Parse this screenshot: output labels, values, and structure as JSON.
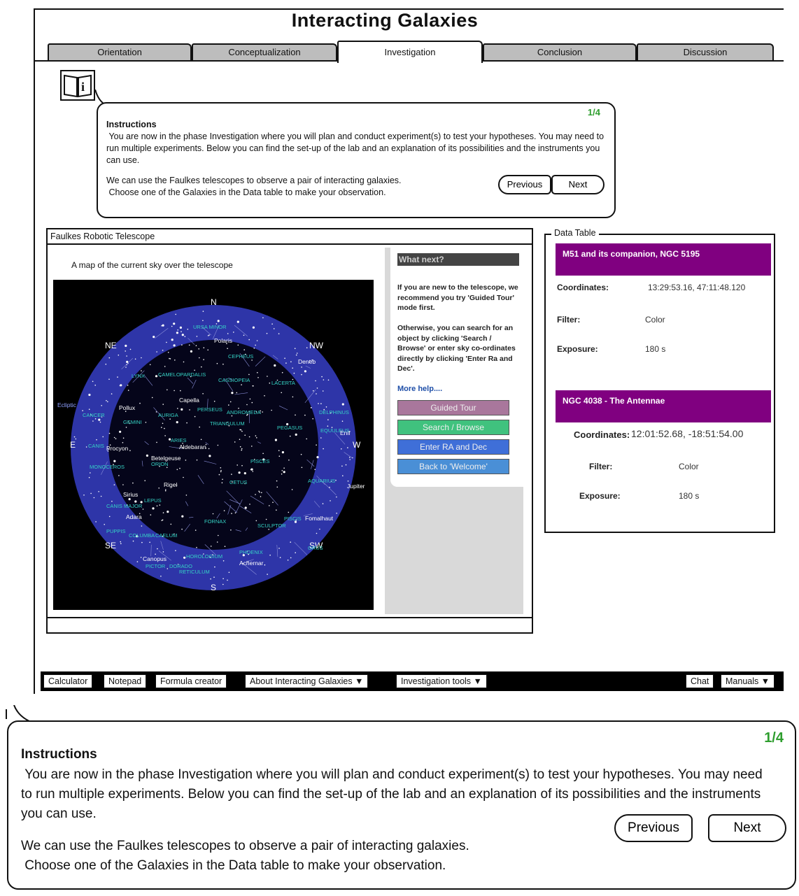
{
  "app": {
    "title": "Interacting Galaxies"
  },
  "tabs": [
    {
      "label": "Orientation"
    },
    {
      "label": "Conceptualization"
    },
    {
      "label": "Investigation",
      "active": true
    },
    {
      "label": "Conclusion"
    },
    {
      "label": "Discussion"
    }
  ],
  "instructions": {
    "counter": "1/4",
    "title": "Instructions",
    "paragraph1": " You are now in the phase Investigation where you will plan and conduct experiment(s) to test your hypotheses. You may need to run multiple experiments. Below you can find the set-up of the lab and an explanation of its possibilities and the instruments you can use.",
    "paragraph2": "We can use the Faulkes telescopes to observe a pair of interacting galaxies.\n Choose one of the Galaxies in the Data table to make your observation.",
    "previous_label": "Previous",
    "next_label": "Next"
  },
  "telescope": {
    "header": "Faulkes Robotic Telescope",
    "map_caption": "A map of the current sky over the telescope",
    "compass": {
      "n": "N",
      "s": "S",
      "e": "E",
      "w": "W",
      "ne": "NE",
      "nw": "NW",
      "se": "SE",
      "sw": "SW"
    },
    "sky_labels": [
      "URSA MINOR",
      "Polaris",
      "CEPHEUS",
      "Deneb",
      "LYNX",
      "CAMELOPARDALIS",
      "CASSIOPEIA",
      "LACERTA",
      "Ecliptic",
      "Pollux",
      "Capella",
      "PERSEUS",
      "ANDROMEDA",
      "DELPHINUS",
      "CANCER",
      "GEMINI",
      "AURIGA",
      "TRIANGULUM",
      "PEGASUS",
      "EQUULEUS",
      "Enif",
      "CANIS",
      "Procyon",
      "Aldebaran",
      "ARIES",
      "Betelgeuse",
      "MONOCEROS",
      "ORION",
      "PISCES",
      "AQUARIUS",
      "Jupiter",
      "Rigel",
      "CETUS",
      "Sirius",
      "LEPUS",
      "CANIS MAJOR",
      "Adara",
      "FORNAX",
      "SCULPTOR",
      "PISCIS",
      "Fomalhaut",
      "PUPPIS",
      "COLUMBA",
      "CAELUM",
      "GRUS",
      "Canopus",
      "HOROLOGIUM",
      "PHOENIX",
      "Achernar",
      "PICTOR",
      "DORADO",
      "RETICULUM"
    ],
    "what_next_title": "What next?",
    "what_next_text1": "If you are new to the telescope, we recommend you try 'Guided Tour' mode first.",
    "what_next_text2": "Otherwise, you can search for an object by clicking 'Search / Browse' or enter sky co-ordinates directly by clicking 'Enter Ra and Dec'.",
    "more_help": "More help....",
    "buttons": {
      "guided_tour": "Guided Tour",
      "search_browse": "Search / Browse",
      "enter_ra_dec": "Enter RA and Dec",
      "back_welcome": "Back to 'Welcome'"
    },
    "button_colors": {
      "guided_tour": "#a9779c",
      "search_browse": "#40c27e",
      "enter_ra_dec": "#3f6fd8",
      "back_welcome": "#4a8fd6"
    }
  },
  "data_table": {
    "legend": "Data Table",
    "galaxies": [
      {
        "name": "M51 and its companion, NGC 5195",
        "coordinates_label": "Coordinates:",
        "coordinates": "13:29:53.16, 47:11:48.120",
        "filter_label": "Filter:",
        "filter": "Color",
        "exposure_label": "Exposure:",
        "exposure": "180 s"
      },
      {
        "name": "NGC 4038 - The Antennae",
        "coordinates_label": "Coordinates:",
        "coordinates": "12:01:52.68, -18:51:54.00",
        "filter_label": "Filter:",
        "filter": "Color",
        "exposure_label": "Exposure:",
        "exposure": "180 s"
      }
    ],
    "header_color": "#800080"
  },
  "toolbar": {
    "calculator": "Calculator",
    "notepad": "Notepad",
    "formula_creator": "Formula creator",
    "about": "About Interacting Galaxies  ▼",
    "investigation_tools": "Investigation tools  ▼",
    "chat": "Chat",
    "manuals": "Manuals  ▼"
  }
}
